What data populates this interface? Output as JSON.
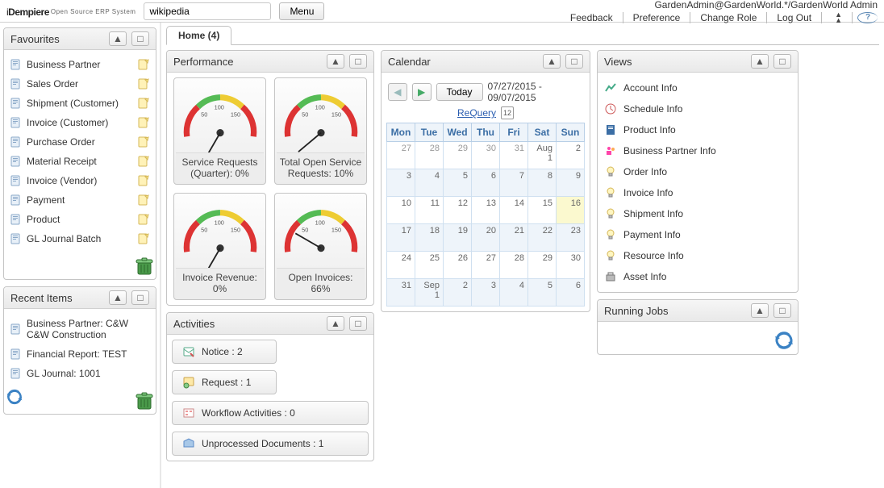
{
  "brand": {
    "name_i": "i",
    "name_d": "Dempiere",
    "sub": "Open Source ERP System"
  },
  "search": {
    "value": "wikipedia",
    "menu_label": "Menu"
  },
  "top": {
    "user": "GardenAdmin@GardenWorld.*/GardenWorld Admin",
    "links": [
      "Feedback",
      "Preference",
      "Change Role",
      "Log Out"
    ]
  },
  "tab": {
    "label": "Home (4)"
  },
  "favourites": {
    "title": "Favourites",
    "items": [
      "Business Partner",
      "Sales Order",
      "Shipment (Customer)",
      "Invoice (Customer)",
      "Purchase Order",
      "Material Receipt",
      "Invoice (Vendor)",
      "Payment",
      "Product",
      "GL Journal Batch"
    ]
  },
  "recent": {
    "title": "Recent Items",
    "items": [
      "Business Partner: C&W C&W Construction",
      "Financial Report: TEST",
      "GL Journal: 1001"
    ]
  },
  "performance": {
    "title": "Performance",
    "gauges": [
      {
        "label": "Service Requests (Quarter): 0%"
      },
      {
        "label": "Total Open Service Requests: 10%"
      },
      {
        "label": "Invoice Revenue: 0%"
      },
      {
        "label": "Open Invoices: 66%"
      }
    ]
  },
  "activities": {
    "title": "Activities",
    "buttons": [
      "Notice : 2",
      "Request : 1",
      "Workflow Activities : 0",
      "Unprocessed Documents : 1"
    ]
  },
  "calendar": {
    "title": "Calendar",
    "today": "Today",
    "range": "07/27/2015 - 09/07/2015",
    "requery": "ReQuery",
    "headers": [
      "Mon",
      "Tue",
      "Wed",
      "Thu",
      "Fri",
      "Sat",
      "Sun"
    ]
  },
  "views": {
    "title": "Views",
    "items": [
      "Account Info",
      "Schedule Info",
      "Product Info",
      "Business Partner Info",
      "Order Info",
      "Invoice Info",
      "Shipment Info",
      "Payment Info",
      "Resource Info",
      "Asset Info"
    ]
  },
  "running": {
    "title": "Running Jobs"
  }
}
